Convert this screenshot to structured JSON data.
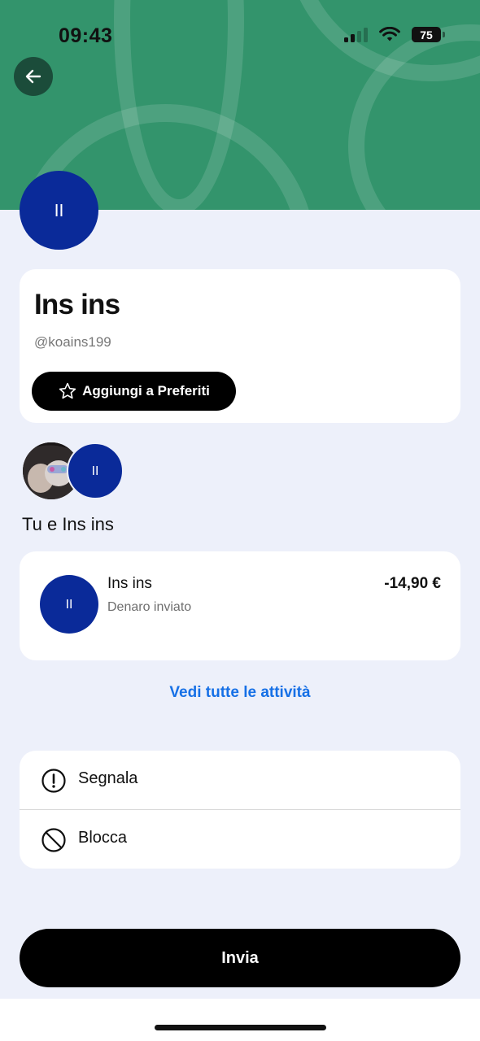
{
  "status_bar": {
    "time": "09:43",
    "battery": "75",
    "battery_level": 0.75
  },
  "header": {
    "back_icon": "arrow-left-icon",
    "header_color": "#33946c"
  },
  "profile": {
    "avatar_initials": "II",
    "name": "Ins ins",
    "handle": "@koains199",
    "favorite_icon": "star-outline-icon",
    "favorite_label": "Aggiungi a Preferiti"
  },
  "shared": {
    "user_photo": "user-photo",
    "avatar_initials": "II",
    "label": "Tu e Ins ins"
  },
  "transaction": {
    "avatar_initials": "II",
    "name": "Ins ins",
    "description": "Denaro inviato",
    "amount": "-14,90 €"
  },
  "see_all_label": "Vedi tutte le attività",
  "actions": [
    {
      "icon": "alert-circle-icon",
      "label": "Segnala"
    },
    {
      "icon": "block-icon",
      "label": "Blocca"
    }
  ],
  "send_label": "Invia",
  "colors": {
    "accent_green": "#33946c",
    "avatar_blue": "#0a2a99",
    "link_blue": "#1670e6",
    "background": "#edf0fa"
  }
}
